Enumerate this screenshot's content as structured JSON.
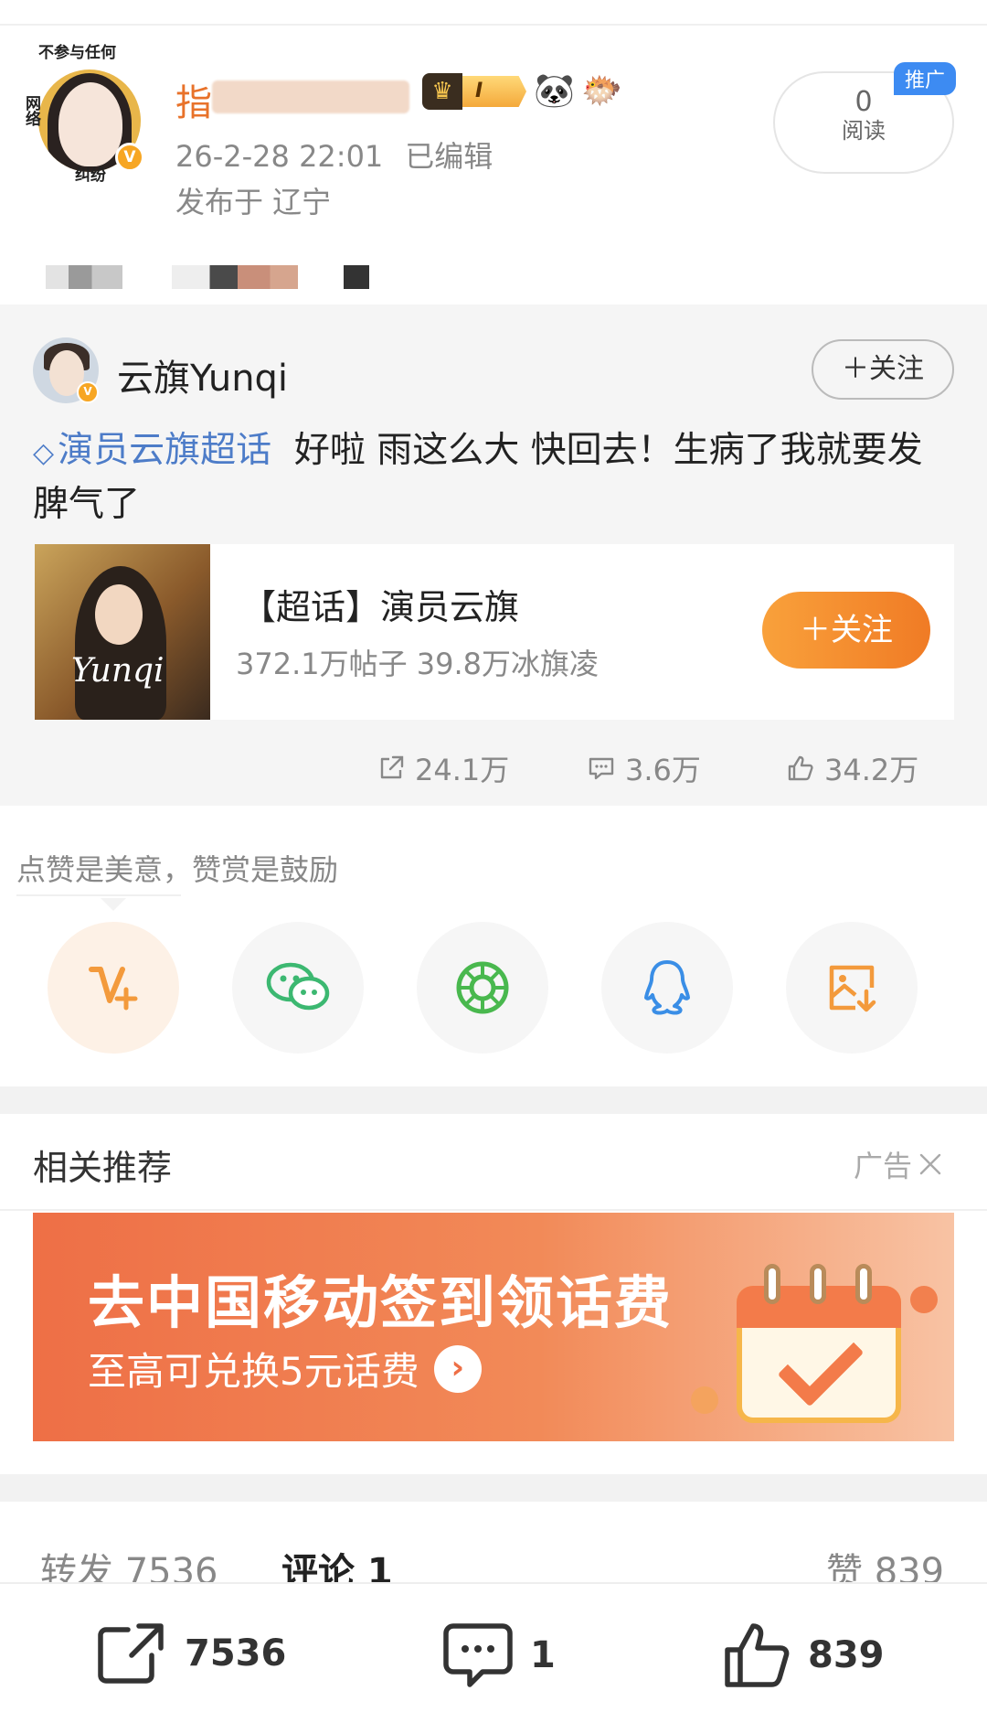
{
  "post": {
    "author_name_prefix": "指",
    "avatar_text_top": "不参与任何",
    "avatar_text_left": "网络",
    "avatar_text_bottom": "纠纷",
    "vip_level": "I",
    "date": "26-2-28 22:01",
    "edited": "已编辑",
    "location": "发布于 辽宁",
    "read_count": "0",
    "read_label": "阅读",
    "promo_tag": "推广"
  },
  "shared": {
    "author": "云旗Yunqi",
    "follow_label": "＋关注",
    "topic_link": "演员云旗超话",
    "text": "好啦 雨这么大 快回去！生病了我就要发脾气了",
    "topic_card": {
      "title": "【超话】演员云旗",
      "stats": "372.1万帖子 39.8万冰旗凌",
      "follow_label": "＋关注",
      "thumb_signature": "Yunqi"
    },
    "repost_count": "24.1万",
    "comment_count": "3.6万",
    "like_count": "34.2万"
  },
  "reward": {
    "hint": "点赞是美意，赞赏是鼓励",
    "share_targets": [
      "reward-icon",
      "wechat-icon",
      "moments-icon",
      "qq-icon",
      "save-image-icon"
    ]
  },
  "related": {
    "title": "相关推荐",
    "ad_label": "广告",
    "banner_title": "去中国移动签到领话费",
    "banner_sub": "至高可兑换5元话费"
  },
  "tabs": {
    "repost": "转发 7536",
    "comment": "评论 1",
    "like": "赞 839"
  },
  "bottom_bar": {
    "repost": "7536",
    "comment": "1",
    "like": "839"
  },
  "colors": {
    "accent_orange": "#f07b25",
    "link_blue": "#4d7cc8",
    "author_orange": "#e8722a",
    "promo_blue": "#3d8bf2"
  }
}
